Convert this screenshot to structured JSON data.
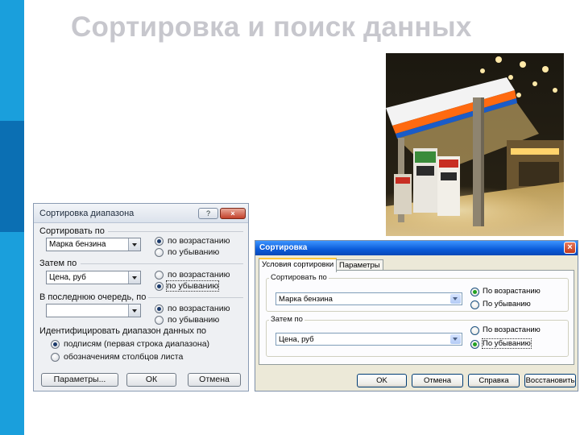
{
  "slide": {
    "title": "Сортировка и поиск данных",
    "accent_light": "#1a9fdc",
    "accent_dark": "#0b6fb3"
  },
  "dialog_office": {
    "title": "Сортировка диапазона",
    "help_icon": "?",
    "close_icon": "×",
    "sort_by_label": "Сортировать по",
    "sort_by_value": "Марка бензина",
    "then_by_label": "Затем по",
    "then_by_value": "Цена, руб",
    "last_by_label": "В последнюю очередь, по",
    "last_by_value": "",
    "asc_label": "по возрастанию",
    "desc_label": "по убыванию",
    "identify_label": "Идентифицировать диапазон данных по",
    "opt_headers": "подписям (первая строка диапазона)",
    "opt_columns": "обозначениям столбцов листа",
    "btn_params": "Параметры...",
    "btn_ok": "ОК",
    "btn_cancel": "Отмена"
  },
  "dialog_xp": {
    "title": "Сортировка",
    "close_icon": "×",
    "tab_conditions": "Условия сортировки",
    "tab_params": "Параметры",
    "sort_by_label": "Сортировать по",
    "sort_by_value": "Марка бензина",
    "then_by_label": "Затем по",
    "then_by_value": "Цена, руб",
    "asc_label": "По возрастанию",
    "desc_label": "По убыванию",
    "btn_ok": "OK",
    "btn_cancel": "Отмена",
    "btn_help": "Справка",
    "btn_restore": "Восстановить"
  }
}
